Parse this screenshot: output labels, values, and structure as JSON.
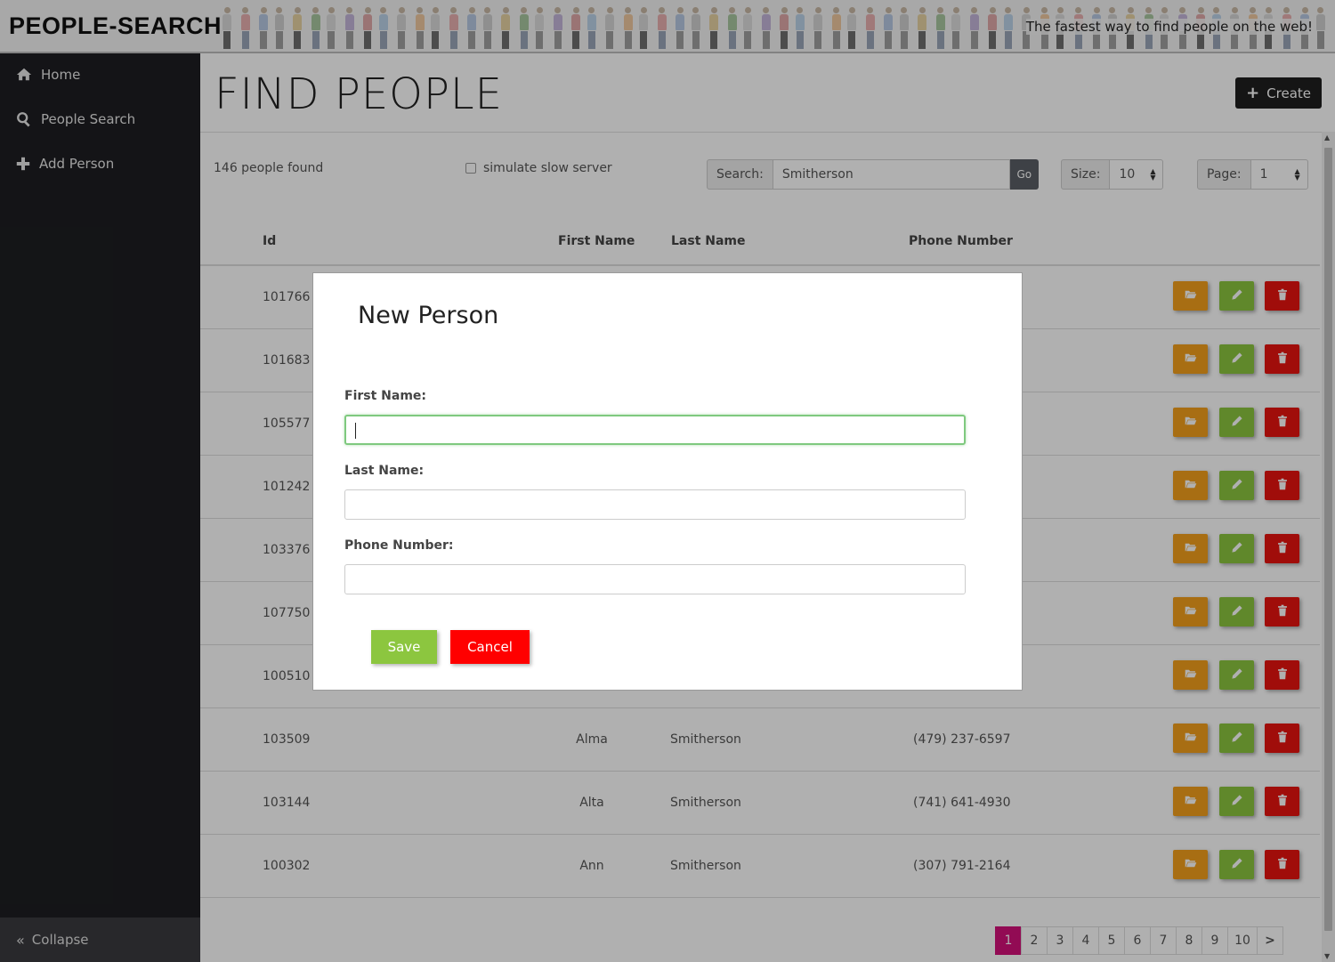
{
  "header": {
    "logo": "PEOPLE-SEARCH",
    "tagline": "The fastest way to find people on the web!"
  },
  "sidebar": {
    "items": [
      {
        "label": "Home",
        "icon": "home-icon"
      },
      {
        "label": "People Search",
        "icon": "search-icon"
      },
      {
        "label": "Add Person",
        "icon": "plus-icon"
      }
    ],
    "collapse_label": "Collapse"
  },
  "main": {
    "title": "FIND PEOPLE",
    "create_label": "Create",
    "count_text": "146 people found",
    "simulate_label": "simulate slow server",
    "search": {
      "label": "Search:",
      "value": "Smitherson",
      "go_label": "Go"
    },
    "size": {
      "label": "Size:",
      "value": "10"
    },
    "page": {
      "label": "Page:",
      "value": "1"
    }
  },
  "table": {
    "headers": [
      "Id",
      "First Name",
      "Last Name",
      "Phone Number"
    ],
    "rows": [
      {
        "id": "101766",
        "first": "",
        "last": "",
        "phone": ""
      },
      {
        "id": "101683",
        "first": "",
        "last": "",
        "phone": ""
      },
      {
        "id": "105577",
        "first": "",
        "last": "",
        "phone": ""
      },
      {
        "id": "101242",
        "first": "",
        "last": "",
        "phone": ""
      },
      {
        "id": "103376",
        "first": "",
        "last": "",
        "phone": ""
      },
      {
        "id": "107750",
        "first": "",
        "last": "",
        "phone": ""
      },
      {
        "id": "100510",
        "first": "",
        "last": "",
        "phone": ""
      },
      {
        "id": "103509",
        "first": "Alma",
        "last": "Smitherson",
        "phone": "(479) 237-6597"
      },
      {
        "id": "103144",
        "first": "Alta",
        "last": "Smitherson",
        "phone": "(741) 641-4930"
      },
      {
        "id": "100302",
        "first": "Ann",
        "last": "Smitherson",
        "phone": "(307) 791-2164"
      }
    ]
  },
  "pagination": {
    "pages": [
      "1",
      "2",
      "3",
      "4",
      "5",
      "6",
      "7",
      "8",
      "9",
      "10"
    ],
    "active": "1"
  },
  "modal": {
    "title": "New Person",
    "first_name_label": "First Name:",
    "last_name_label": "Last Name:",
    "phone_label": "Phone Number:",
    "first_name_value": "",
    "last_name_value": "",
    "phone_value": "",
    "save_label": "Save",
    "cancel_label": "Cancel"
  },
  "colors": {
    "sidebar_bg": "#1d1e22",
    "open_button": "#f4a01c",
    "edit_button": "#8cc63f",
    "delete_button": "#e8140f",
    "active_page": "#d4107a",
    "save_button": "#8cc63f",
    "cancel_button": "#ff0000"
  }
}
